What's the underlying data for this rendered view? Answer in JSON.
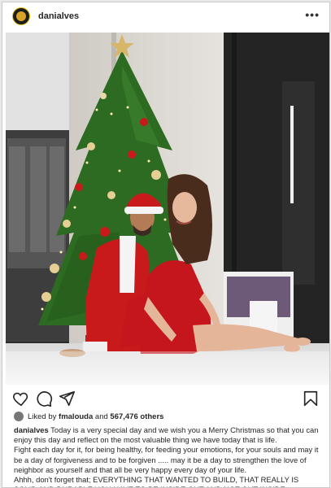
{
  "post": {
    "username": "danialves"
  },
  "likes": {
    "prefix": "Liked by",
    "liker": "fmalouda",
    "and": "and",
    "count": "567,476 others"
  },
  "caption": {
    "username": "danialves",
    "line1": "Today is a very special day and we wish you a Merry Christmas so that you can enjoy this day and reflect on the most valuable thing we have today that is life.",
    "line2": "Fight each day for it, for being healthy, for feeding your emotions, for your souls and may it be a day of forgiveness and to be forgiven ..... may it be a day to strengthen the love of neighbor as yourself and that all be very happy every day of your life.",
    "line3": "Ahhh, don't forget that; EVERYTHING THAT WANTED TO BUILD, THAT REALLY IS SOLID AND DURABLE YOU HAVE TO BE INSIDE OUT AND NOT OUT INSIDE"
  },
  "icons": {
    "like": "heart-icon",
    "comment": "comment-icon",
    "share": "share-icon",
    "save": "bookmark-icon",
    "more": "more-options-icon"
  },
  "colors": {
    "tree": "#2e6b22",
    "santa_red": "#c81a1a",
    "dress_red": "#c4161c"
  }
}
